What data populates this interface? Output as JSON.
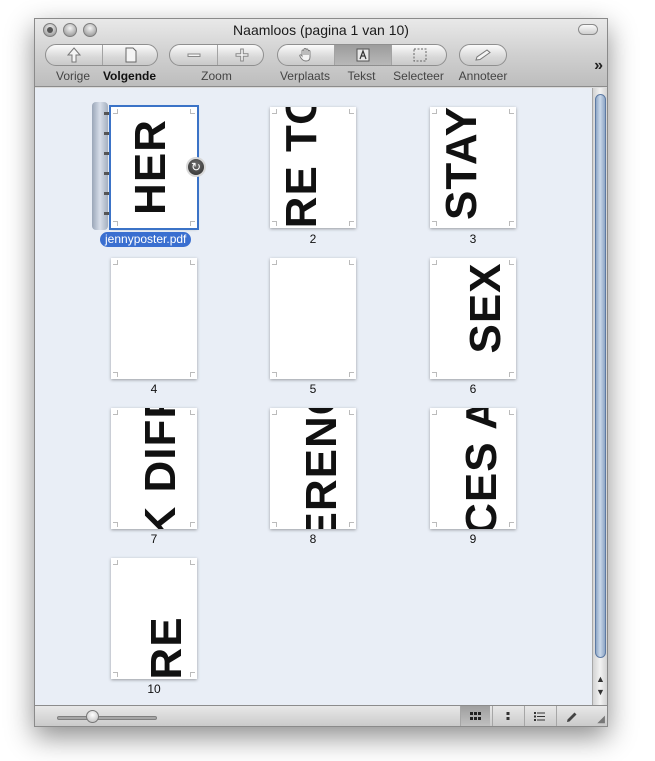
{
  "window": {
    "title": "Naamloos (pagina 1 van 10)"
  },
  "toolbar": {
    "prev_label": "Vorige",
    "next_label": "Volgende",
    "zoom_label": "Zoom",
    "move_label": "Verplaats",
    "text_label": "Tekst",
    "select_label": "Selecteer",
    "annotate_label": "Annoteer",
    "overflow_label": "»"
  },
  "document": {
    "filename": "jennyposter.pdf"
  },
  "pages": [
    {
      "label": "",
      "text": "HER"
    },
    {
      "label": "2",
      "text": "RE TO"
    },
    {
      "label": "3",
      "text": "STAY"
    },
    {
      "label": "4",
      "text": ""
    },
    {
      "label": "5",
      "text": ""
    },
    {
      "label": "6",
      "text": "SEX"
    },
    {
      "label": "7",
      "text": "K DIFFI"
    },
    {
      "label": "8",
      "text": "ERENC"
    },
    {
      "label": "9",
      "text": "CES A"
    },
    {
      "label": "10",
      "text": "RE"
    }
  ],
  "bottombar": {
    "zoom_level": 0.35
  },
  "colors": {
    "selection": "#3b73c7",
    "content_bg": "#e9eef6"
  }
}
